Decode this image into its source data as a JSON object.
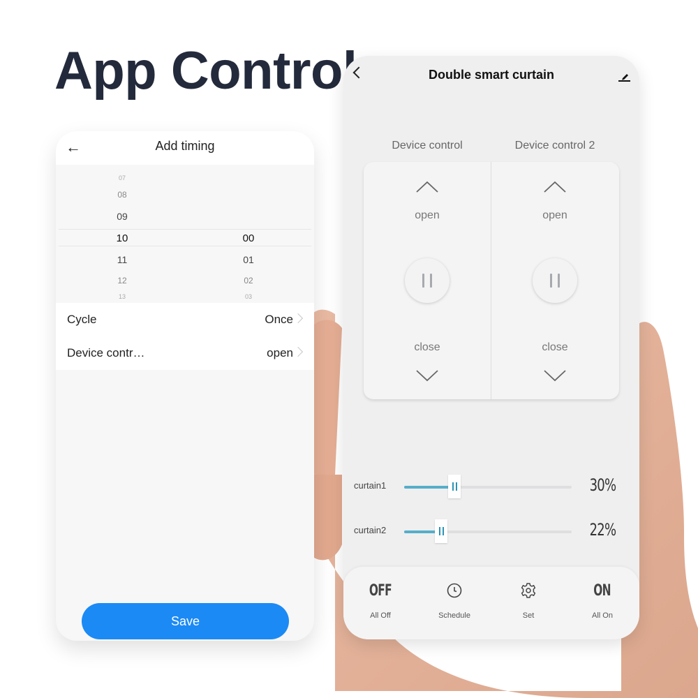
{
  "headline": "App Control",
  "colors": {
    "headline": "#232a3b",
    "save_button": "#1b8af5",
    "slider_fill": "#55aec9",
    "slider_thumb_mark": "#2a93b6"
  },
  "add_timing": {
    "title": "Add timing",
    "back_icon": "arrow-left-icon",
    "hours": [
      "07",
      "08",
      "09",
      "10",
      "11",
      "12",
      "13"
    ],
    "selected_hour": "10",
    "minutes": [
      "00",
      "01",
      "02",
      "03"
    ],
    "selected_minute": "00",
    "rows": [
      {
        "label": "Cycle",
        "value": "Once"
      },
      {
        "label": "Device contr…",
        "value": "open"
      }
    ],
    "save_label": "Save"
  },
  "curtain_app": {
    "title": "Double smart curtain",
    "back_icon": "chevron-left-icon",
    "edit_icon": "pencil-icon",
    "controls": [
      {
        "title": "Device control",
        "open_label": "open",
        "close_label": "close"
      },
      {
        "title": "Device control 2",
        "open_label": "open",
        "close_label": "close"
      }
    ],
    "sliders": [
      {
        "label": "curtain1",
        "value": 30,
        "display": "30%"
      },
      {
        "label": "curtain2",
        "value": 22,
        "display": "22%"
      }
    ],
    "bottom_bar": [
      {
        "icon": "off-text-icon",
        "icon_text": "OFF",
        "label": "All Off"
      },
      {
        "icon": "clock-icon",
        "label": "Schedule"
      },
      {
        "icon": "gear-icon",
        "label": "Set"
      },
      {
        "icon": "on-text-icon",
        "icon_text": "ON",
        "label": "All On"
      }
    ]
  }
}
